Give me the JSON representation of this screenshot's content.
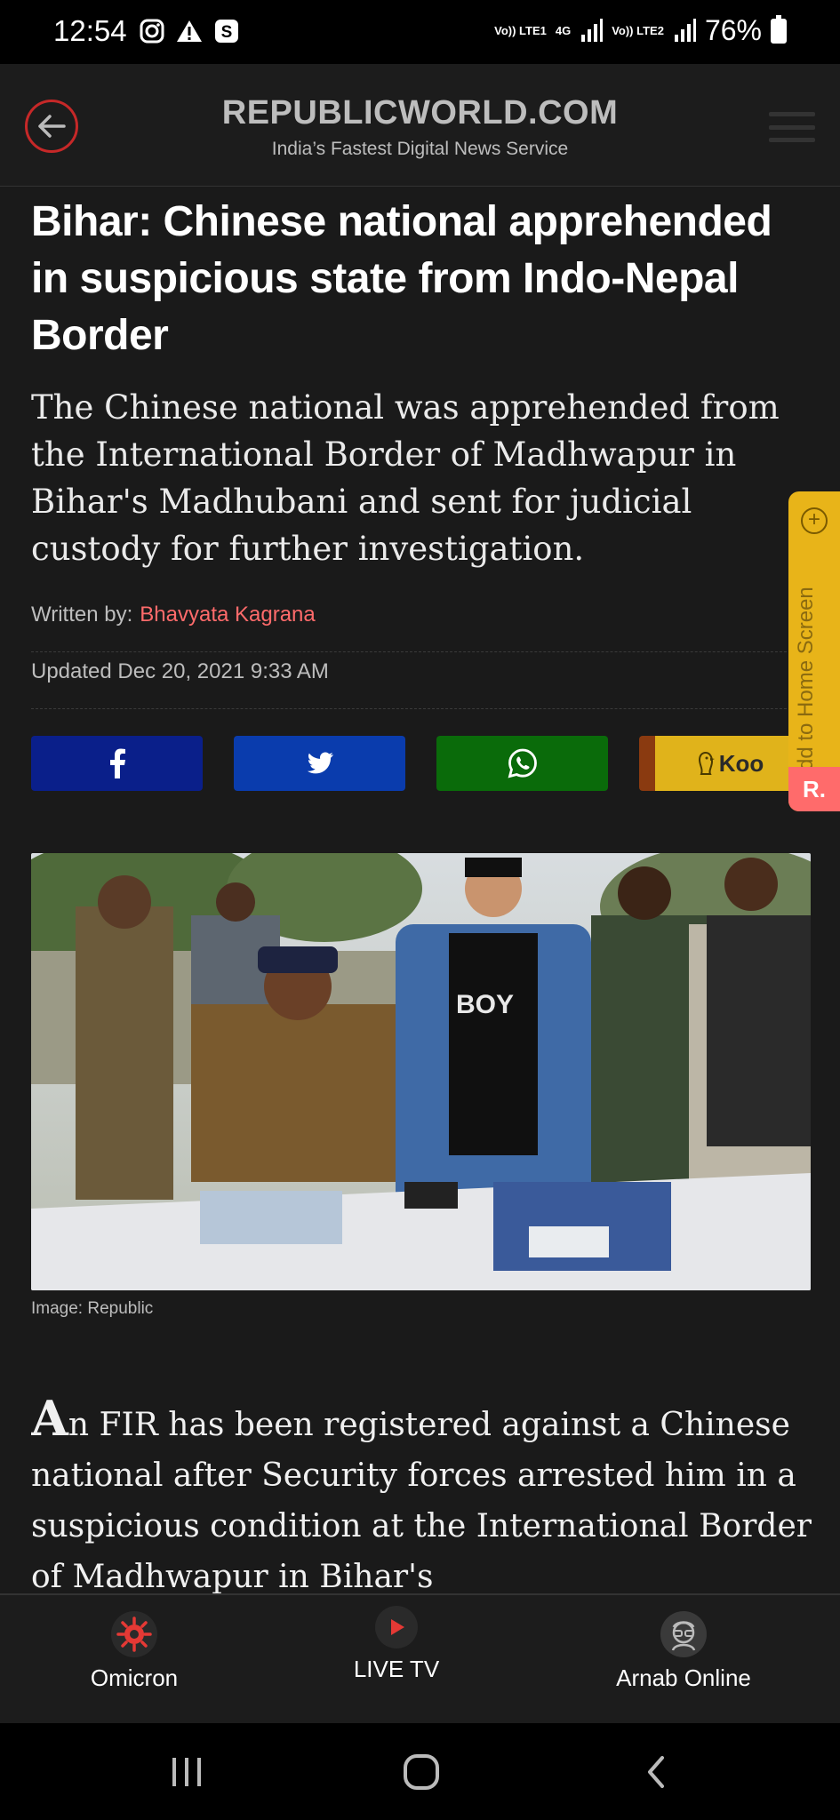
{
  "status": {
    "time": "12:54",
    "net1": "Vo)) LTE1",
    "net_type": "4G",
    "net2": "Vo)) LTE2",
    "battery": "76%"
  },
  "header": {
    "brand": "REPUBLICWORLD.COM",
    "tagline": "India’s Fastest Digital News Service"
  },
  "article": {
    "headline": "Bihar: Chinese national apprehended in suspicious state from Indo-Nepal Border",
    "subhead": "The Chinese national was apprehended from the International Border of Madhwapur in Bihar's Madhubani and sent for judicial custody for further investigation.",
    "written_by_label": "Written by:",
    "author": "Bhavyata Kagrana",
    "updated": "Updated Dec 20, 2021 9:33 AM",
    "image_caption": "Image: Republic",
    "body_dropcap": "A",
    "body_rest": "n FIR has been registered against a Chinese national after Security forces arrested him in a suspicious condition at the International Border of Madhwapur in Bihar's"
  },
  "share": {
    "facebook_color": "#0a1f8a",
    "twitter_color": "#0a3cad",
    "whatsapp_color": "#0a6b0a",
    "koo_label": "Koo"
  },
  "side_tab": {
    "label": "Add to Home Screen",
    "logo": "R."
  },
  "bottom_nav": {
    "items": [
      {
        "label": "Omicron",
        "icon": "virus-icon"
      },
      {
        "label": "LIVE TV",
        "icon": "play-icon"
      },
      {
        "label": "Arnab Online",
        "icon": "avatar-icon"
      }
    ]
  }
}
